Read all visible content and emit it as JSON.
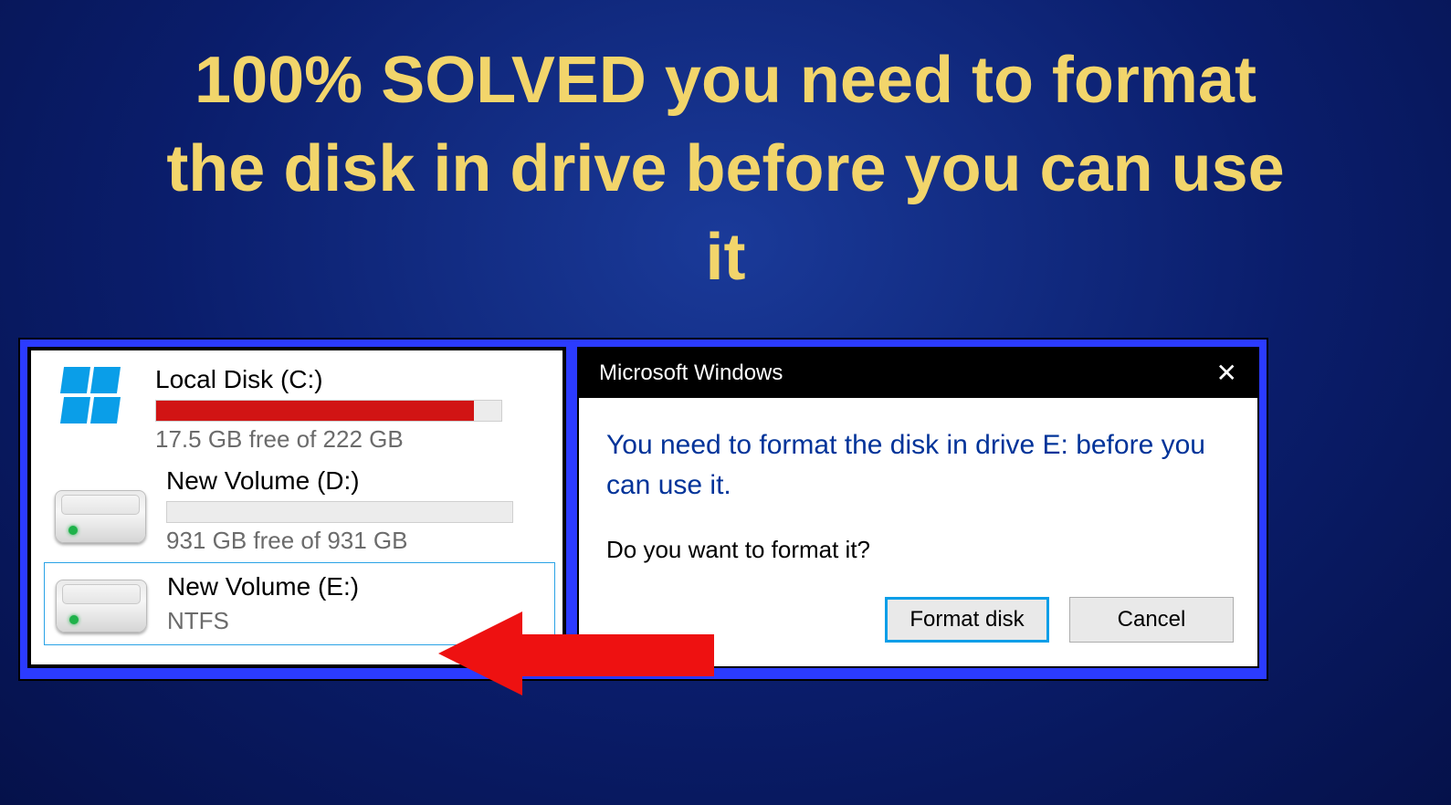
{
  "headline": "100% SOLVED you need to format the disk in drive before you can use it",
  "drives": [
    {
      "name": "Local Disk (C:)",
      "usage_percent": 92,
      "free_text": "17.5 GB free of 222 GB",
      "show_bar": true
    },
    {
      "name": "New Volume (D:)",
      "usage_percent": 0,
      "free_text": "931 GB free of 931 GB",
      "show_bar": true
    },
    {
      "name": "New Volume (E:)",
      "fs": "NTFS",
      "selected": true,
      "show_bar": false
    }
  ],
  "dialog": {
    "title": "Microsoft Windows",
    "instruction": "You need to format the disk in drive E: before you can use it.",
    "question": "Do you want to format it?",
    "buttons": {
      "format": "Format disk",
      "cancel": "Cancel"
    }
  }
}
